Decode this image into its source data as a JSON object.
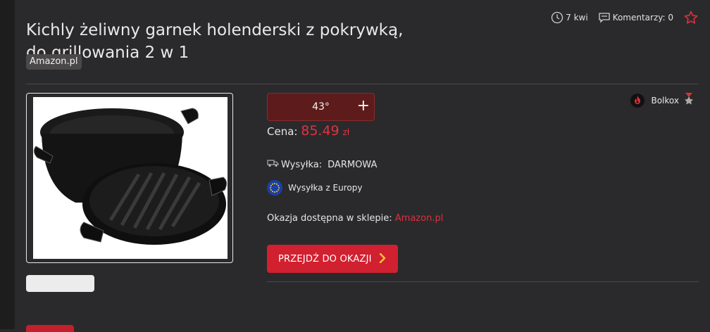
{
  "deal": {
    "title": "Kichly żeliwny garnek holenderski z pokrywką, do grillowania 2 w 1",
    "shop_tag": "Amazon.pl",
    "posted": "7 kwi",
    "comments_label": "Komentarzy: 0",
    "temperature": "43°",
    "vote_up": "+",
    "price_label": "Cena:",
    "price": "85.49",
    "currency": "zł",
    "shipping_label": "Wysyłka:",
    "shipping_value": "DARMOWA",
    "origin": "Wysyłka z Europy",
    "store_label": "Okazja dostępna w sklepie:",
    "store_link": "Amazon.pl",
    "cta_label": "PRZEJDŹ DO OKAZJI"
  },
  "user": {
    "name": "Bolkox"
  },
  "colors": {
    "accent": "#d1202f",
    "price": "#e3323f",
    "background": "#2a2a2c"
  },
  "icons": {
    "clock": "clock-icon",
    "comment": "comment-icon",
    "star": "star-icon",
    "truck": "truck-icon",
    "eu": "eu-flag-icon",
    "chevron": "chevron-right-icon",
    "avatar": "fire-avatar-icon",
    "badge": "medal-badge-icon"
  }
}
